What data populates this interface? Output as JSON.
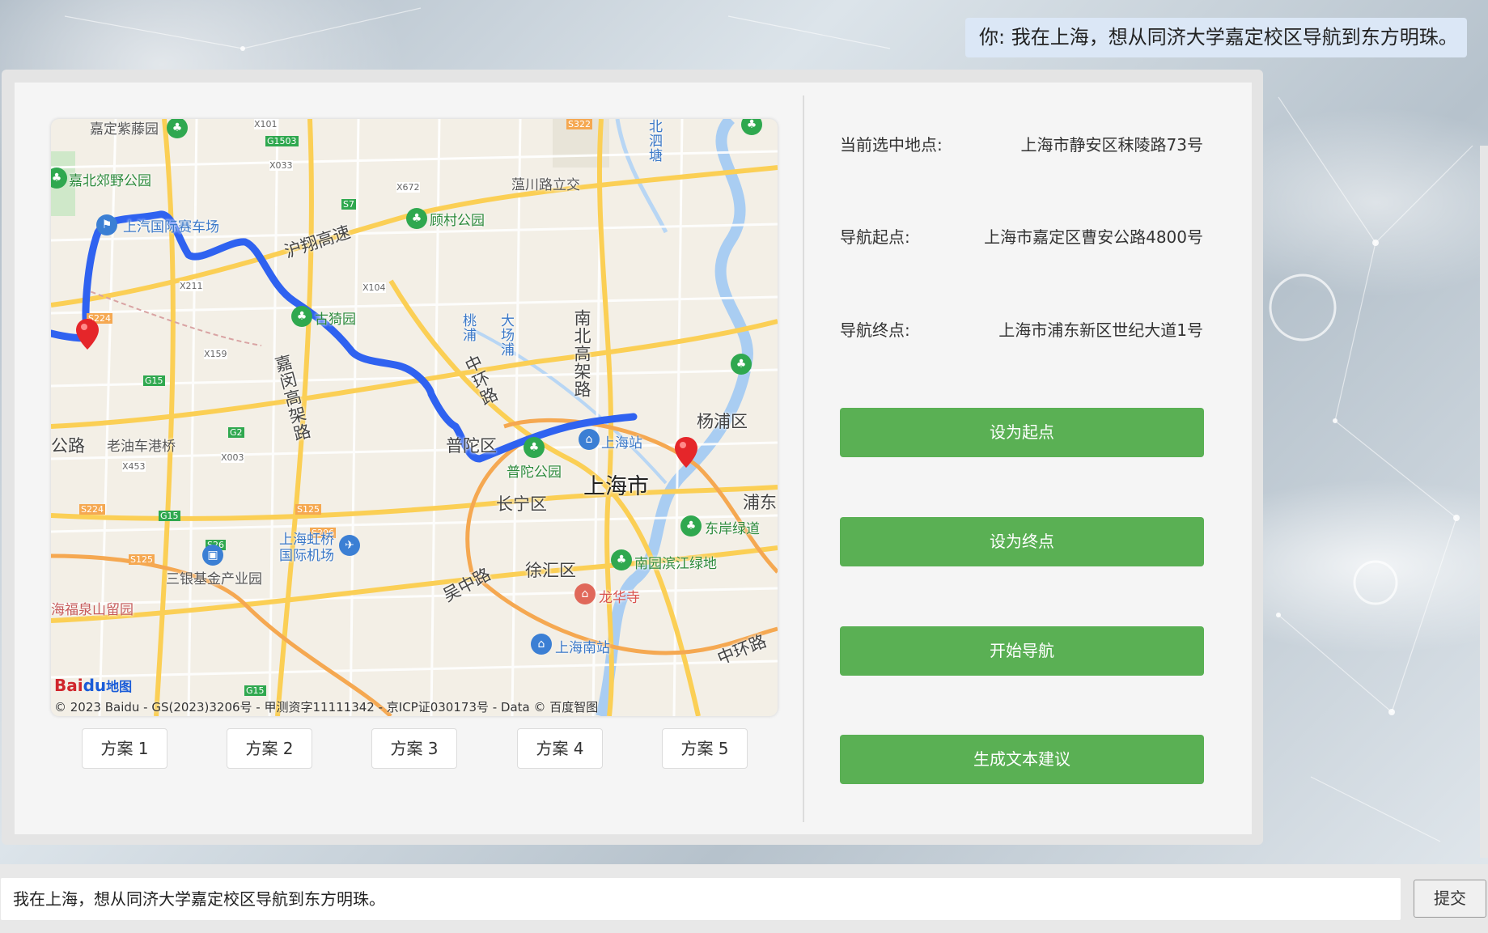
{
  "chat": {
    "user_message": "你: 我在上海，想从同济大学嘉定校区导航到东方明珠。"
  },
  "map": {
    "labels": {
      "jiading_zitengyuan": "嘉定紫藤园",
      "jiabei_park": "嘉北郊野公园",
      "circuit": "上汽国际赛车场",
      "huxiang_highway": "沪翔高速",
      "gucun_park": "顾村公园",
      "yunchuan_interchange": "蕰川路立交",
      "beisitang": "北泗塘",
      "guyiyuan": "古猗园",
      "taopu": "桃浦",
      "dachangpu": "大场浦",
      "nanbei_elevated": "南北高架路",
      "jiamin_elevated": "嘉闵高架路",
      "middle_ring": "中环路",
      "laoyou_bridge": "老油车港桥",
      "gonglu": "公路",
      "putuo": "普陀区",
      "putuo_park": "普陀公园",
      "shanghai_station": "上海站",
      "yangpu": "杨浦区",
      "shanghai_city": "上海市",
      "changning": "长宁区",
      "pudong": "浦东",
      "dongan_greenway": "东岸绿道",
      "hongqiao_airport": "上海虹桥国际机场",
      "sanyin": "三银基金产业园",
      "xuhui": "徐汇区",
      "nanyuan_greenland": "南园滨江绿地",
      "wuzhong_road": "吴中路",
      "longhua_temple": "龙华寺",
      "fuquanshan": "海福泉山留园",
      "shanghai_south": "上海南站",
      "middle_ring_se": "中环路"
    },
    "road_shields": [
      "X101",
      "G1503",
      "X033",
      "X672",
      "S7",
      "X211",
      "X104",
      "S224",
      "X159",
      "G15",
      "G2",
      "X003",
      "X453",
      "S224",
      "G15",
      "S125",
      "S206",
      "S26",
      "S125",
      "S322",
      "G15"
    ],
    "baidu_logo_a": "Bai",
    "baidu_logo_b": "du",
    "baidu_logo_c": "地图",
    "copyright": "© 2023 Baidu - GS(2023)3206号 - 甲测资字11111342 - 京ICP证030173号 - Data © 百度智图"
  },
  "plans": [
    "方案 1",
    "方案 2",
    "方案 3",
    "方案 4",
    "方案 5"
  ],
  "info": {
    "selected_label": "当前选中地点:",
    "selected_value": "上海市静安区秣陵路73号",
    "start_label": "导航起点:",
    "start_value": "上海市嘉定区曹安公路4800号",
    "end_label": "导航终点:",
    "end_value": "上海市浦东新区世纪大道1号"
  },
  "actions": {
    "set_start": "设为起点",
    "set_end": "设为终点",
    "start_nav": "开始导航",
    "gen_text": "生成文本建议"
  },
  "input": {
    "value": "我在上海，想从同济大学嘉定校区导航到东方明珠。",
    "submit": "提交"
  },
  "colors": {
    "accent_green": "#5ab054",
    "route_blue": "#2f62f0",
    "bubble_blue": "#dbe7f6"
  }
}
